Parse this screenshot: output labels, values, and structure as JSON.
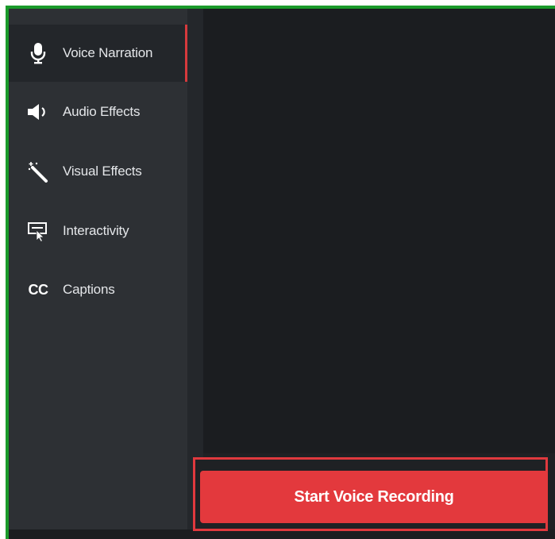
{
  "sidebar": {
    "items": [
      {
        "label": "Voice Narration",
        "icon": "microphone-icon",
        "active": true
      },
      {
        "label": "Audio Effects",
        "icon": "speaker-icon",
        "active": false
      },
      {
        "label": "Visual Effects",
        "icon": "magic-wand-icon",
        "active": false
      },
      {
        "label": "Interactivity",
        "icon": "interactivity-icon",
        "active": false
      },
      {
        "label": "Captions",
        "icon": "closed-captions-icon",
        "icon_text": "CC",
        "active": false
      }
    ]
  },
  "main": {
    "record_button_label": "Start Voice Recording"
  },
  "colors": {
    "highlight_border": "#1a9a2a",
    "accent_red": "#e3393d",
    "sidebar_bg": "#2d3034",
    "main_bg": "#1b1d20"
  }
}
